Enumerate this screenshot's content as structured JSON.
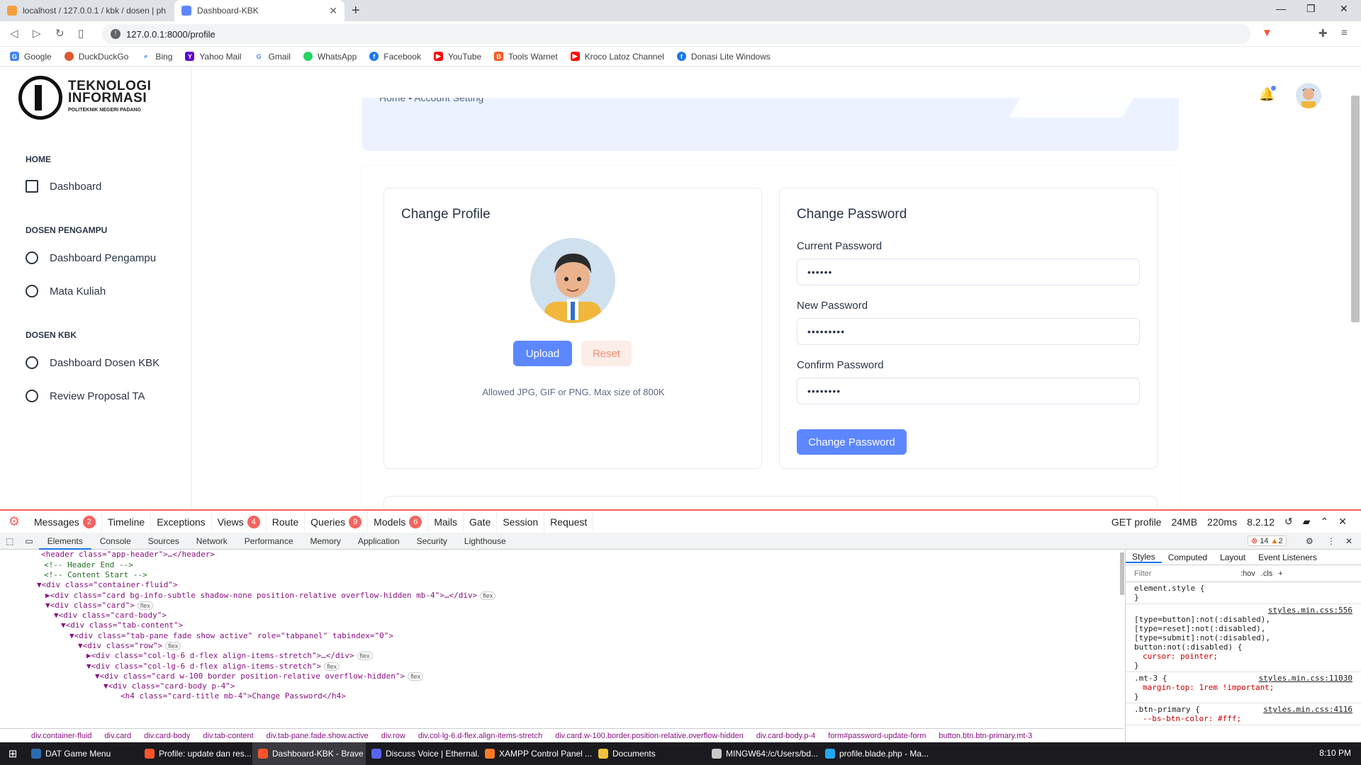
{
  "browser": {
    "tabs": [
      {
        "title": "localhost / 127.0.0.1 / kbk / dosen | ph",
        "active": false
      },
      {
        "title": "Dashboard-KBK",
        "active": true
      }
    ],
    "url": "127.0.0.1:8000/profile",
    "bookmarks": [
      "Google",
      "DuckDuckGo",
      "Bing",
      "Yahoo Mail",
      "Gmail",
      "WhatsApp",
      "Facebook",
      "YouTube",
      "Tools Warnet",
      "Kroco Latoz Channel",
      "Donasi Lite Windows"
    ]
  },
  "logo": {
    "line1": "TEKNOLOGI",
    "line2": "INFORMASI",
    "line3": "POLITEKNIK NEGERI PADANG"
  },
  "sidebar": {
    "sections": [
      {
        "title": "HOME",
        "items": [
          "Dashboard"
        ]
      },
      {
        "title": "DOSEN PENGAMPU",
        "items": [
          "Dashboard Pengampu",
          "Mata Kuliah"
        ]
      },
      {
        "title": "DOSEN KBK",
        "items": [
          "Dashboard Dosen KBK",
          "Review Proposal TA"
        ]
      }
    ]
  },
  "breadcrumb": {
    "home": "Home",
    "sep": "•",
    "current": "Account Setting"
  },
  "profile": {
    "title": "Change Profile",
    "upload": "Upload",
    "reset": "Reset",
    "hint": "Allowed JPG, GIF or PNG. Max size of 800K"
  },
  "password": {
    "title": "Change Password",
    "current_label": "Current Password",
    "current_value": "••••••",
    "new_label": "New Password",
    "new_value": "•••••••••",
    "confirm_label": "Confirm Password",
    "confirm_value": "••••••••",
    "button": "Change Password"
  },
  "debugbar": {
    "items": [
      {
        "label": "Messages",
        "badge": "2"
      },
      {
        "label": "Timeline"
      },
      {
        "label": "Exceptions"
      },
      {
        "label": "Views",
        "badge": "4"
      },
      {
        "label": "Route"
      },
      {
        "label": "Queries",
        "badge": "9"
      },
      {
        "label": "Models",
        "badge": "6"
      },
      {
        "label": "Mails"
      },
      {
        "label": "Gate"
      },
      {
        "label": "Session"
      },
      {
        "label": "Request"
      }
    ],
    "method": "GET profile",
    "memory": "24MB",
    "time": "220ms",
    "php": "8.2.12"
  },
  "devtools": {
    "tabs": [
      "Elements",
      "Console",
      "Sources",
      "Network",
      "Performance",
      "Memory",
      "Application",
      "Security",
      "Lighthouse"
    ],
    "errors": "14",
    "warnings": "2",
    "dom": [
      {
        "indent": 0,
        "text": "<header class=\"app-header\">…</header>",
        "type": "tag"
      },
      {
        "indent": 0,
        "text": "<!--  Header End -->",
        "type": "comment"
      },
      {
        "indent": 0,
        "text": "<!--  Content Start -->",
        "type": "comment"
      },
      {
        "indent": 0,
        "text": "▼<div class=\"container-fluid\">",
        "type": "tag"
      },
      {
        "indent": 1,
        "text": "▶<div class=\"card bg-info-subtle shadow-none position-relative overflow-hidden mb-4\">…</div>",
        "type": "tag",
        "flex": true
      },
      {
        "indent": 1,
        "text": "▼<div class=\"card\">",
        "type": "tag",
        "flex": true
      },
      {
        "indent": 2,
        "text": "▼<div class=\"card-body\">",
        "type": "tag"
      },
      {
        "indent": 3,
        "text": "▼<div class=\"tab-content\">",
        "type": "tag"
      },
      {
        "indent": 4,
        "text": "▼<div class=\"tab-pane fade show active\" role=\"tabpanel\" tabindex=\"0\">",
        "type": "tag"
      },
      {
        "indent": 5,
        "text": "▼<div class=\"row\">",
        "type": "tag",
        "flex": true
      },
      {
        "indent": 6,
        "text": "▶<div class=\"col-lg-6 d-flex align-items-stretch\">…</div>",
        "type": "tag",
        "flex": true
      },
      {
        "indent": 6,
        "text": "▼<div class=\"col-lg-6 d-flex align-items-stretch\">",
        "type": "tag",
        "flex": true
      },
      {
        "indent": 7,
        "text": "▼<div class=\"card w-100 border position-relative overflow-hidden\">",
        "type": "tag",
        "flex": true
      },
      {
        "indent": 8,
        "text": "▼<div class=\"card-body p-4\">",
        "type": "tag"
      },
      {
        "indent": 9,
        "text": "<h4 class=\"card-title mb-4\">Change Password</h4>",
        "type": "tag"
      }
    ],
    "crumbs": [
      "div.container-fluid",
      "div.card",
      "div.card-body",
      "div.tab-content",
      "div.tab-pane.fade.show.active",
      "div.row",
      "div.col-lg-6.d-flex.align-items-stretch",
      "div.card.w-100.border.position-relative.overflow-hidden",
      "div.card-body.p-4",
      "form#password-update-form",
      "button.btn.btn-primary.mt-3"
    ],
    "style_tabs": [
      "Styles",
      "Computed",
      "Layout",
      "Event Listeners"
    ],
    "filter": "Filter",
    "hov": ":hov",
    ".cls": ".cls",
    "rules": [
      {
        "sel": "element.style {",
        "src": "",
        "body": [
          "}"
        ]
      },
      {
        "sel": "[type=button]:not(:disabled), [type=reset]:not(:disabled), [type=submit]:not(:disabled), button:not(:disabled) {",
        "src": "styles.min.css:556",
        "body": [
          "cursor: pointer;",
          "}"
        ]
      },
      {
        "sel": ".mt-3 {",
        "src": "styles.min.css:11030",
        "body": [
          "margin-top: 1rem !important;",
          "}"
        ]
      },
      {
        "sel": ".btn-primary {",
        "src": "styles.min.css:4116",
        "body": [
          "--bs-btn-color: #fff;"
        ]
      }
    ]
  },
  "taskbar": {
    "items": [
      "DAT Game Menu",
      "Profile: update dan res...",
      "Dashboard-KBK - Brave",
      "Discuss Voice | Ethernal...",
      "XAMPP Control Panel ...",
      "Documents",
      "MINGW64:/c/Users/bd...",
      "profile.blade.php - Ma..."
    ],
    "time": "8:10 PM"
  },
  "colors": {
    "primary": "#5d87ff",
    "reset_bg": "#fdede8",
    "reset_text": "#fa896b",
    "debug_red": "#f4645f"
  }
}
